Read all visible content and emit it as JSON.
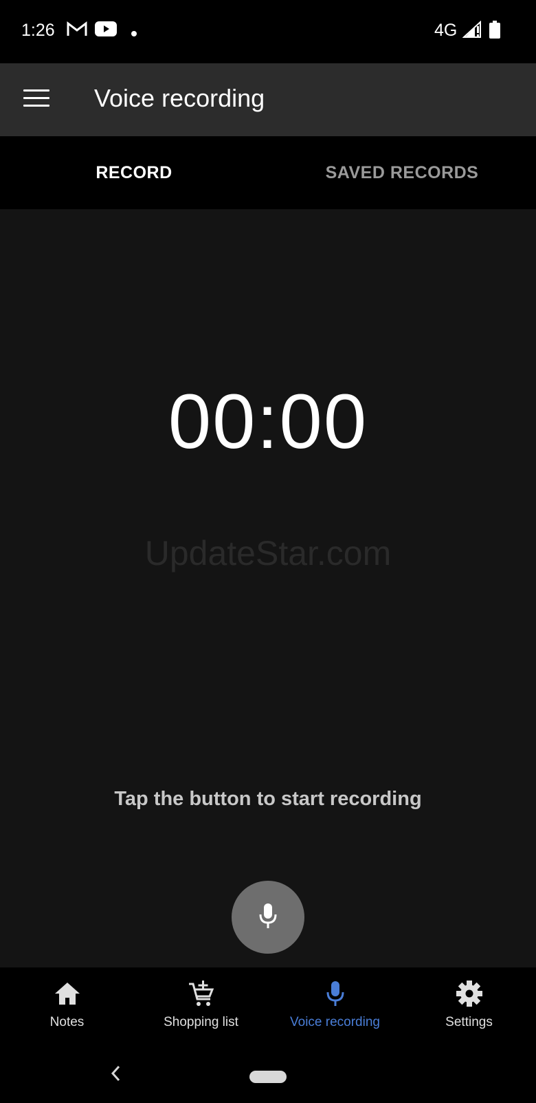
{
  "status_bar": {
    "time": "1:26",
    "network": "4G",
    "icons": [
      "gmail-icon",
      "youtube-icon",
      "dot-icon",
      "signal-icon",
      "battery-icon"
    ]
  },
  "app_bar": {
    "title": "Voice recording"
  },
  "tabs": [
    {
      "label": "RECORD",
      "active": true
    },
    {
      "label": "SAVED RECORDS",
      "active": false
    }
  ],
  "main": {
    "timer": "00:00",
    "watermark": "UpdateStar.com",
    "hint": "Tap the button to start recording"
  },
  "bottom_nav": {
    "items": [
      {
        "label": "Notes",
        "icon": "home-icon",
        "active": false
      },
      {
        "label": "Shopping list",
        "icon": "cart-add-icon",
        "active": false
      },
      {
        "label": "Voice recording",
        "icon": "mic-icon",
        "active": true
      },
      {
        "label": "Settings",
        "icon": "gear-icon",
        "active": false
      }
    ]
  },
  "colors": {
    "accent": "#4a7ed8",
    "background": "#141414",
    "app_bar": "#2c2c2c",
    "fab": "#6e6e6e"
  }
}
